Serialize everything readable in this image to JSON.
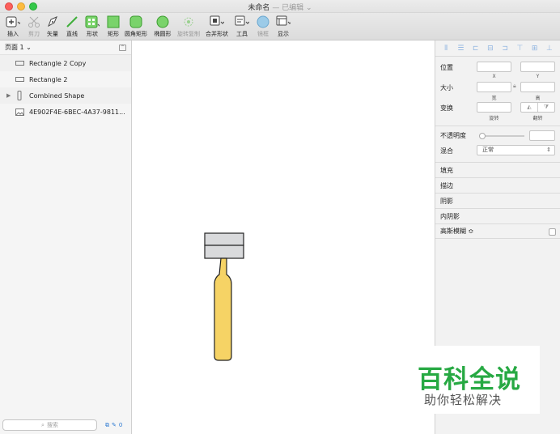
{
  "window": {
    "title": "未命名",
    "edited": "— 已编辑 ⌄"
  },
  "toolbar": {
    "insert": "插入",
    "scissors": "剪刀",
    "vector": "矢量",
    "line": "直线",
    "shape": "形状",
    "rect": "矩形",
    "round_rect": "圆角矩形",
    "oval": "椭圆形",
    "rotate_copy": "旋转复制",
    "combine": "合并形状",
    "tools": "工具",
    "mirror": "镜框",
    "view": "显示"
  },
  "sidebar": {
    "page_label": "页面 1 ⌄",
    "layers": [
      {
        "name": "Rectangle 2 Copy"
      },
      {
        "name": "Rectangle 2"
      },
      {
        "name": "Combined Shape"
      },
      {
        "name": "4E902F4E-6BEC-4A37-9811..."
      }
    ],
    "search_placeholder": "搜索",
    "count": "0"
  },
  "inspector": {
    "position": "位置",
    "x": "X",
    "y": "Y",
    "size": "大小",
    "width": "宽",
    "height": "高",
    "transform": "变换",
    "rotate": "旋转",
    "flip": "翻转",
    "opacity": "不透明度",
    "blend": "混合",
    "blend_value": "正常",
    "fill": "填充",
    "border": "描边",
    "shadow": "阴影",
    "inner_shadow": "内阴影",
    "blur": "高斯模糊 ≎"
  },
  "watermark": {
    "title": "百科全说",
    "subtitle": "助你轻松解决"
  },
  "colors": {
    "shape_fill": "#f6d365",
    "head_fill": "#d9dadc",
    "watermark_green": "#27a943"
  }
}
